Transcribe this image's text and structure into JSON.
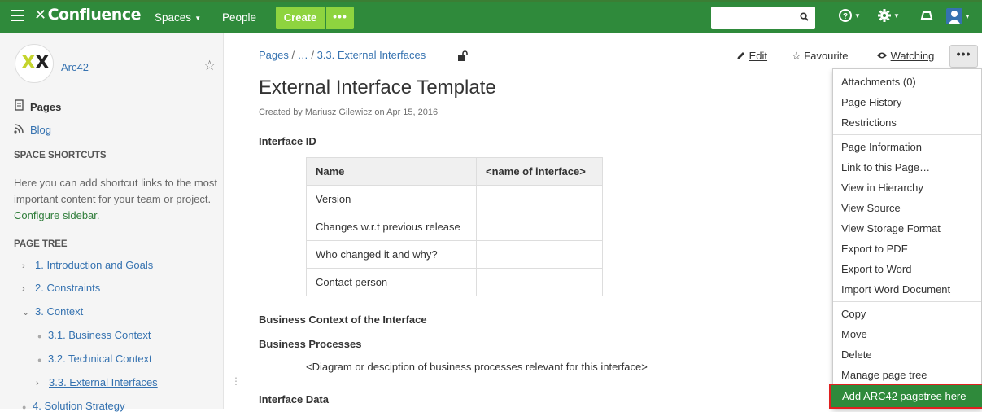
{
  "topnav": {
    "logo": "Confluence",
    "spaces": "Spaces",
    "people": "People",
    "create": "Create",
    "create_more": "•••",
    "search_placeholder": "",
    "help_icon": "?",
    "settings_icon": "gear",
    "notifications_icon": "bell",
    "user_icon": "user"
  },
  "sidebar": {
    "space_name": "Arc42",
    "avatar_left": "X",
    "avatar_right": "X",
    "pages": "Pages",
    "blog": "Blog",
    "shortcuts_heading": "SPACE SHORTCUTS",
    "shortcuts_text": "Here you can add shortcut links to the most important content for your team or project.",
    "configure": "Configure sidebar.",
    "tree_heading": "PAGE TREE",
    "tree": [
      {
        "label": "1. Introduction and Goals",
        "type": "collapsed"
      },
      {
        "label": "2. Constraints",
        "type": "collapsed"
      },
      {
        "label": "3. Context",
        "type": "expanded"
      },
      {
        "label": "3.1. Business Context",
        "type": "leaf"
      },
      {
        "label": "3.2. Technical Context",
        "type": "leaf"
      },
      {
        "label": "3.3. External Interfaces",
        "type": "current"
      },
      {
        "label": "4. Solution Strategy",
        "type": "leaf"
      }
    ]
  },
  "breadcrumb": {
    "pages": "Pages",
    "ellipsis": "…",
    "current": "3.3. External Interfaces"
  },
  "page": {
    "title": "External Interface Template",
    "byline": "Created by Mariusz Gilewicz on Apr 15, 2016",
    "interface_id_heading": "Interface ID",
    "table": {
      "headers": [
        "Name",
        "<name of interface>"
      ],
      "rows": [
        "Version",
        "Changes w.r.t previous release",
        "Who changed it and why?",
        "Contact person"
      ]
    },
    "business_context_heading": "Business Context of the Interface",
    "business_processes_heading": "Business Processes",
    "business_processes_text": "<Diagram or desciption of business processes relevant for this interface>",
    "interface_data_heading": "Interface Data"
  },
  "actions": {
    "edit": "Edit",
    "favourite": "Favourite",
    "watching": "Watching",
    "more": "•••"
  },
  "menu": {
    "group1": [
      "Attachments (0)",
      "Page History",
      "Restrictions"
    ],
    "group2": [
      "Page Information",
      "Link to this Page…",
      "View in Hierarchy",
      "View Source",
      "View Storage Format",
      "Export to PDF",
      "Export to Word",
      "Import Word Document"
    ],
    "group3": [
      "Copy",
      "Move",
      "Delete",
      "Manage page tree"
    ],
    "highlighted": "Add ARC42 pagetree here"
  },
  "colors": {
    "header_green": "#2f8a3b",
    "create_green": "#8ed43f",
    "link_blue": "#3572b0",
    "highlight_border": "#e02020"
  }
}
